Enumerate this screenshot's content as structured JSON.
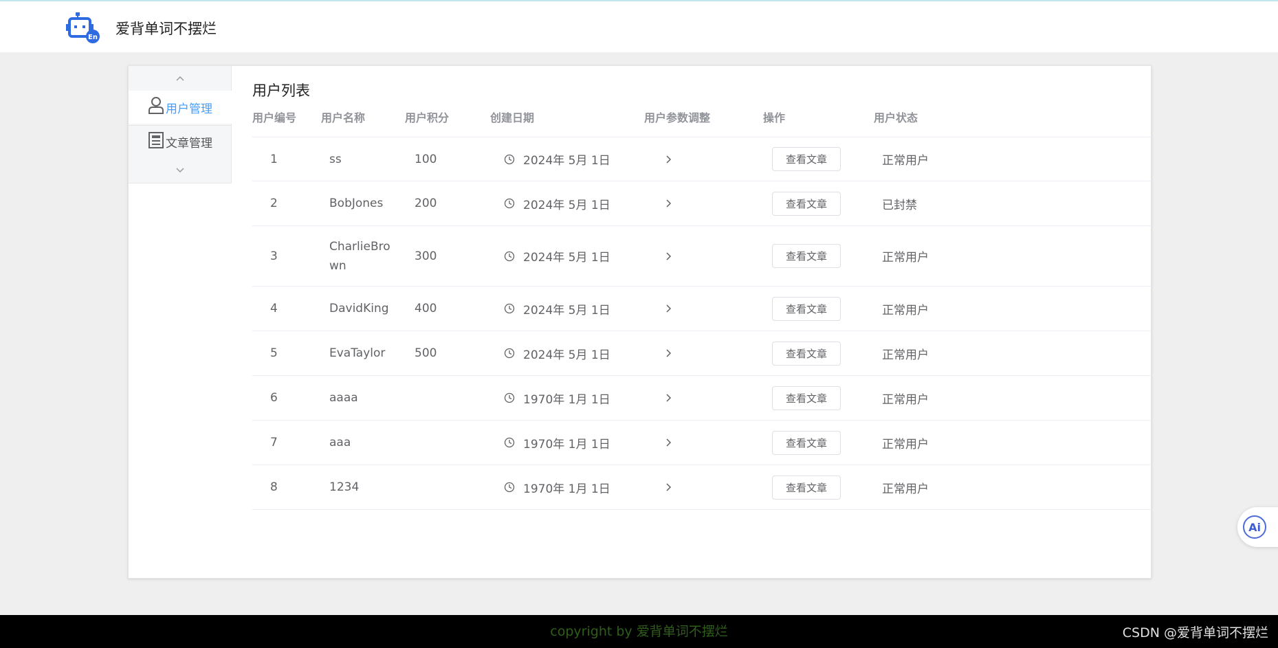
{
  "app": {
    "title": "爱背单词不摆烂"
  },
  "sidebar": {
    "items": [
      {
        "label": "用户管理",
        "icon": "user-icon",
        "active": true
      },
      {
        "label": "文章管理",
        "icon": "article-icon",
        "active": false
      }
    ]
  },
  "list": {
    "title": "用户列表",
    "columns": [
      "用户编号",
      "用户名称",
      "用户积分",
      "创建日期",
      "用户参数调整",
      "操作",
      "用户状态"
    ],
    "rows": [
      {
        "id": "1",
        "name": "ss",
        "score": "100",
        "date": "2024年 5月 1日",
        "action": "查看文章",
        "status": "正常用户"
      },
      {
        "id": "2",
        "name": "BobJones",
        "score": "200",
        "date": "2024年 5月 1日",
        "action": "查看文章",
        "status": "已封禁"
      },
      {
        "id": "3",
        "name": "CharlieBrown",
        "score": "300",
        "date": "2024年 5月 1日",
        "action": "查看文章",
        "status": "正常用户"
      },
      {
        "id": "4",
        "name": "DavidKing",
        "score": "400",
        "date": "2024年 5月 1日",
        "action": "查看文章",
        "status": "正常用户"
      },
      {
        "id": "5",
        "name": "EvaTaylor",
        "score": "500",
        "date": "2024年 5月 1日",
        "action": "查看文章",
        "status": "正常用户"
      },
      {
        "id": "6",
        "name": "aaaa",
        "score": "",
        "date": "1970年 1月 1日",
        "action": "查看文章",
        "status": "正常用户"
      },
      {
        "id": "7",
        "name": "aaa",
        "score": "",
        "date": "1970年 1月 1日",
        "action": "查看文章",
        "status": "正常用户"
      },
      {
        "id": "8",
        "name": "1234",
        "score": "",
        "date": "1970年 1月 1日",
        "action": "查看文章",
        "status": "正常用户"
      }
    ]
  },
  "ai_badge": {
    "label": "Ai"
  },
  "footer": {
    "copyright": "copyright by 爱背单词不摆烂",
    "watermark": "CSDN @爱背单词不摆烂"
  },
  "colors": {
    "accent": "#409eff",
    "footer_bg": "#000000",
    "copyright_text": "#2f5e1a"
  }
}
